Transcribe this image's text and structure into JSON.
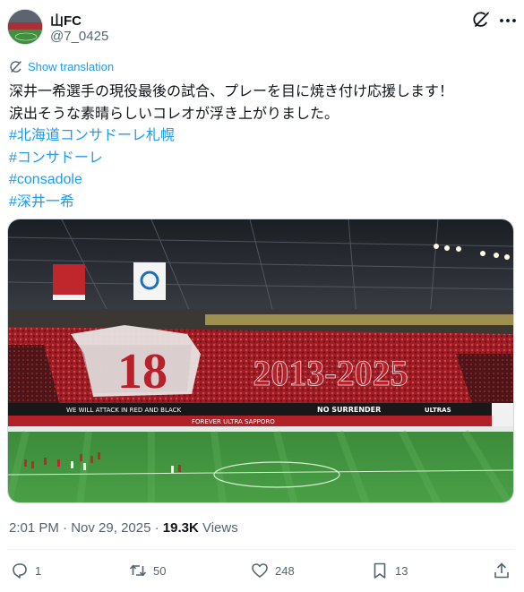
{
  "author": {
    "name": "山FC",
    "handle": "@7_0425"
  },
  "icons": {
    "avatar": "stadium-avatar-image",
    "grok": "grok-slash-circle-icon",
    "more": "more-dots-icon",
    "translate": "globe-translate-icon",
    "reply": "reply-bubble-icon",
    "retweet": "retweet-icon",
    "like": "heart-icon",
    "bookmark": "bookmark-icon",
    "share": "share-upload-icon"
  },
  "translate_label": "Show translation",
  "tweet": {
    "line1": "深井一希選手の現役最後の試合、プレーを目に焼き付け応援します！",
    "line2": "涙出そうな素晴らしいコレオが浮き上がりました。",
    "hashtags": [
      "#北海道コンサドーレ札幌",
      "#コンサドーレ",
      "#consadole",
      "#深井一希"
    ]
  },
  "photo": {
    "tifo_number": "18",
    "tifo_years": "2013-2025",
    "banner_left": "WE WILL ATTACK IN RED AND BLACK",
    "banner_mid": "FOREVER ULTRA SAPPORO",
    "banner_right": "NO SURRENDER",
    "banner_ultras": "ULTRAS"
  },
  "meta": {
    "time": "2:01 PM",
    "sep1": " · ",
    "date": "Nov 29, 2025",
    "sep2": " · ",
    "views_count": "19.3K",
    "views_label": " Views"
  },
  "actions": {
    "replies": "1",
    "retweets": "50",
    "likes": "248",
    "bookmarks": "13"
  },
  "colors": {
    "link": "#1d9bf0",
    "secondary": "#536471",
    "primary_text": "#0f1419",
    "tifo_red": "#b8212a",
    "pitch_green": "#3d8a3a"
  }
}
